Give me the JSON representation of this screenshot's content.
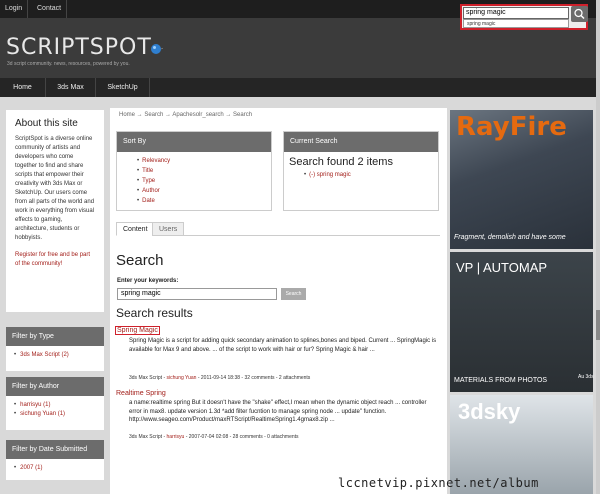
{
  "top_links": [
    "Login",
    "Contact"
  ],
  "logo": {
    "text": "SCRIPTSPOT",
    "tagline": "3d script community. news, resources, powered by you."
  },
  "search_top": {
    "value": "spring magic",
    "suggestion": "spring magic"
  },
  "nav": [
    "Home",
    "3ds Max",
    "SketchUp"
  ],
  "about": {
    "title": "About this site",
    "body": "ScriptSpot is a diverse online community of artists and developers who come together to find and share scripts that empower their creativity with 3ds Max or SketchUp. Our users come from all parts of the world and work in everything from visual effects to gaming, architecture, students or hobbyists.",
    "register": "Register for free and be part of the community!"
  },
  "filters": [
    {
      "title": "Filter by Type",
      "items": [
        "3ds Max Script (2)"
      ]
    },
    {
      "title": "Filter by Author",
      "items": [
        "harrisyu (1)",
        "sichung Yuan (1)"
      ]
    },
    {
      "title": "Filter by Date Submitted",
      "items": [
        "2007 (1)"
      ]
    }
  ],
  "breadcrumb": "Home → Search → Apachesolr_search → Search",
  "sort_by": {
    "title": "Sort By",
    "items": [
      "Relevancy",
      "Title",
      "Type",
      "Author",
      "Date"
    ]
  },
  "current_search": {
    "title": "Current Search",
    "found": "Search found 2 items",
    "item": "(-) spring magic"
  },
  "tabs": [
    "Content",
    "Users"
  ],
  "search_heading": "Search",
  "keywords_label": "Enter your keywords:",
  "keywords_value": "spring magic",
  "search_button": "Search",
  "results_heading": "Search results",
  "results": [
    {
      "title": "Spring Magic",
      "snippet": "Spring Magic is a script for adding quick secondary animation to splines,bones and biped. Current ... SpringMagic is available for Max 9 and above. ... of the script to work with hair or fur? Spring Magic & hair ...",
      "meta_type": "3ds Max Script - ",
      "meta_author": "sichung Yuan",
      "meta_rest": " - 2011-09-14 18:38 - 32 comments - 2 attachments"
    },
    {
      "title": "Realtime Spring",
      "snippet": "a name:realtime spring But it doesn't have the \"shake\" effect,I mean when the dynamic object reach ... controller error in max8. update version 1.3d *add filter fucntion to manage spring node ... update\" function. http://www.seageo.com/Product/maxRTScript/RealtimeSpring1.4gmax8.zip ...",
      "meta_type": "3ds Max Script - ",
      "meta_author": "harrisyu",
      "meta_rest": " - 2007-07-04 02:08 - 28 comments - 0 attachments"
    }
  ],
  "ads": {
    "rayfire": {
      "title": "RayFire",
      "tagline": "Fragment, demolish and have some"
    },
    "automap": {
      "title": "VP | AUTOMAP",
      "caption": "MATERIALS FROM PHOTOS",
      "corner": "Au 3ds"
    },
    "sky": {
      "title": "3dsky"
    }
  },
  "watermark": "lccnetvip.pixnet.net/album",
  "colors": {
    "accent": "#a3201b",
    "highlight_box": "#d0202b",
    "header_bg": "#3b3b3b",
    "panel_head": "#6c6c6c"
  }
}
